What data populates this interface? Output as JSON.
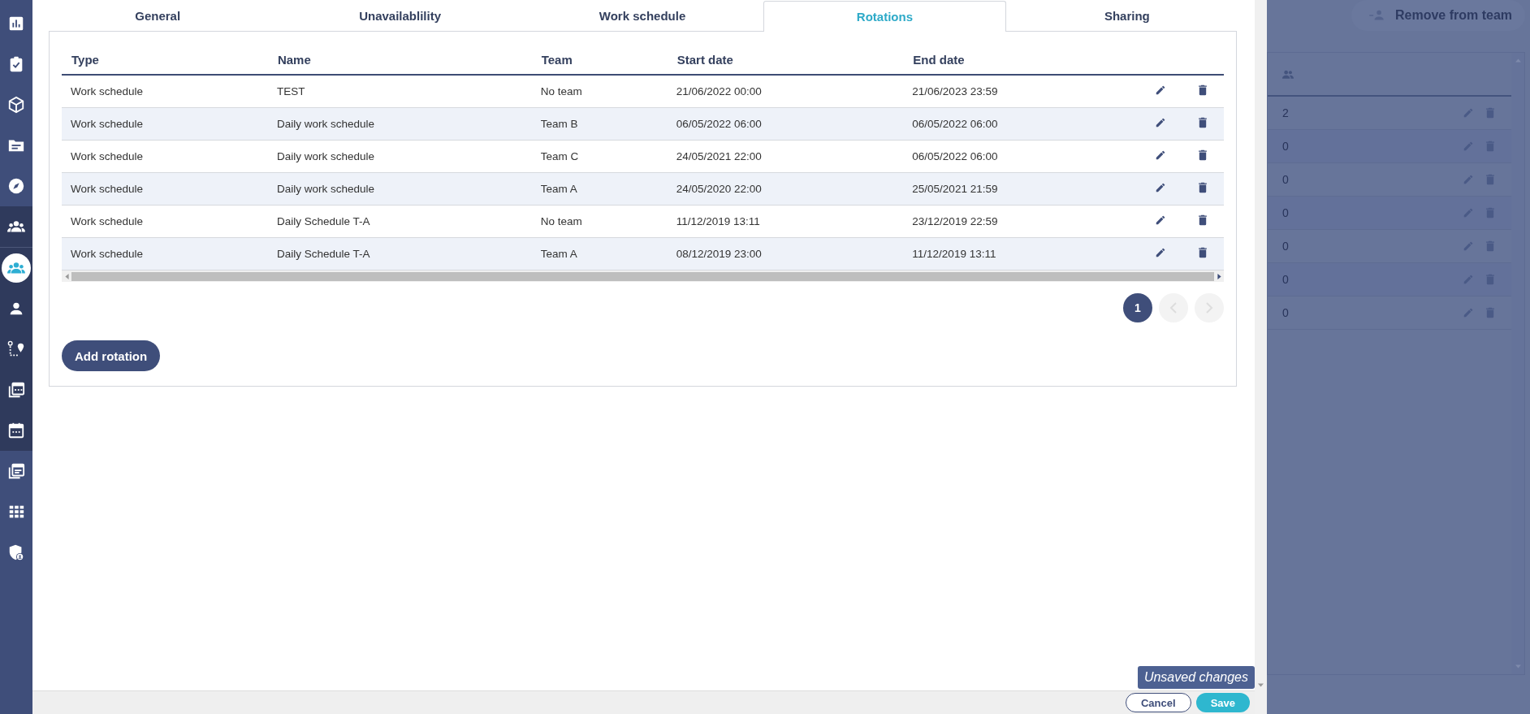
{
  "sidebar": {
    "groups": [
      {
        "kind": "main",
        "items": [
          {
            "selected": false
          },
          {
            "selected": false
          },
          {
            "selected": false
          },
          {
            "selected": false
          },
          {
            "selected": false
          }
        ]
      },
      {
        "kind": "sub",
        "items": [
          {
            "selected": false
          },
          {
            "selected": true
          },
          {
            "selected": false
          },
          {
            "selected": false
          },
          {
            "selected": false
          },
          {
            "selected": false
          }
        ]
      },
      {
        "kind": "main",
        "items": [
          {
            "selected": false
          },
          {
            "selected": false
          },
          {
            "selected": false
          }
        ]
      }
    ]
  },
  "tabs": [
    {
      "label": "General",
      "selected": false
    },
    {
      "label": "Unavailablility",
      "selected": false
    },
    {
      "label": "Work schedule",
      "selected": false
    },
    {
      "label": "Rotations",
      "selected": true
    },
    {
      "label": "Sharing",
      "selected": false
    }
  ],
  "table": {
    "columns": [
      "Type",
      "Name",
      "Team",
      "Start date",
      "End date"
    ],
    "rows": [
      {
        "cells": [
          "Work schedule",
          "TEST",
          "No team",
          "21/06/2022 00:00",
          "21/06/2023 23:59"
        ]
      },
      {
        "cells": [
          "Work schedule",
          "Daily work schedule",
          "Team B",
          "06/05/2022 06:00",
          "06/05/2022 06:00"
        ]
      },
      {
        "cells": [
          "Work schedule",
          "Daily work schedule",
          "Team C",
          "24/05/2021 22:00",
          "06/05/2022 06:00"
        ]
      },
      {
        "cells": [
          "Work schedule",
          "Daily work schedule",
          "Team A",
          "24/05/2020 22:00",
          "25/05/2021 21:59"
        ]
      },
      {
        "cells": [
          "Work schedule",
          "Daily Schedule T-A",
          "No team",
          "11/12/2019 13:11",
          "23/12/2019 22:59"
        ]
      },
      {
        "cells": [
          "Work schedule",
          "Daily Schedule T-A",
          "Team A",
          "08/12/2019 23:00",
          "11/12/2019 13:11"
        ]
      }
    ]
  },
  "pagination": {
    "pages": [
      {
        "label": "1",
        "selected": true
      }
    ],
    "previous": {
      "disabled": true
    },
    "next": {
      "disabled": true
    }
  },
  "add_button": "Add rotation",
  "unsaved_badge": "Unsaved changes",
  "footer": {
    "buttons": [
      {
        "label": "Cancel",
        "kind": "secondary"
      },
      {
        "label": "Save",
        "kind": "primary"
      }
    ]
  },
  "background_panel": {
    "button": "Remove from team",
    "rows": [
      {
        "count": "2"
      },
      {
        "count": "0"
      },
      {
        "count": "0"
      },
      {
        "count": "0"
      },
      {
        "count": "0"
      },
      {
        "count": "0"
      },
      {
        "count": "0"
      }
    ]
  }
}
